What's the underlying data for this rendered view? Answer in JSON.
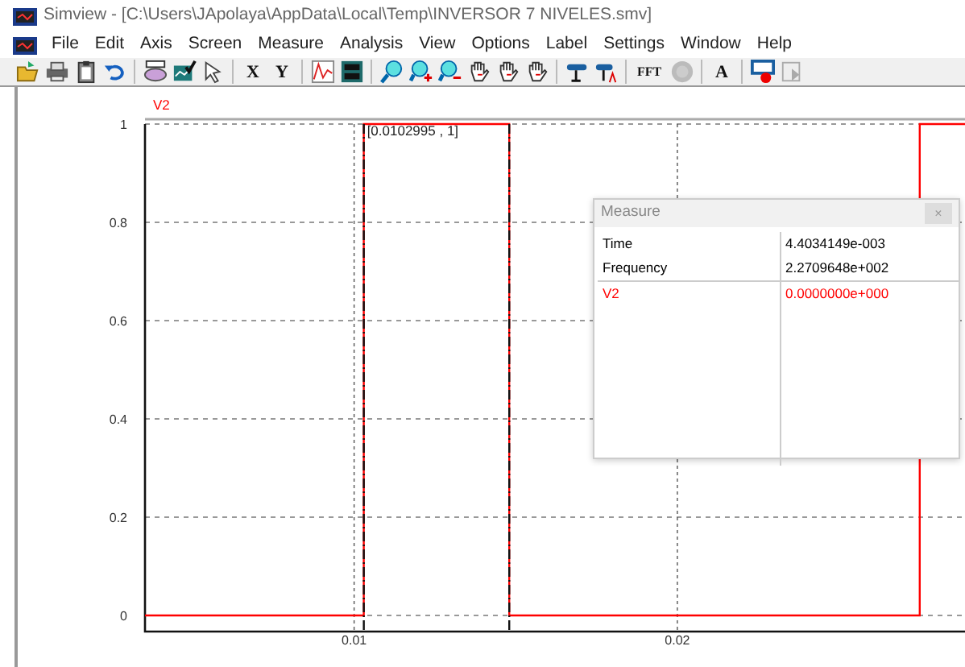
{
  "window": {
    "title": "Simview - [C:\\Users\\JApolaya\\AppData\\Local\\Temp\\INVERSOR 7 NIVELES.smv]"
  },
  "menu": [
    "File",
    "Edit",
    "Axis",
    "Screen",
    "Measure",
    "Analysis",
    "View",
    "Options",
    "Label",
    "Settings",
    "Window",
    "Help"
  ],
  "toolbar": {
    "labels": [
      "X",
      "Y",
      "FFT",
      "A"
    ]
  },
  "plot": {
    "chart_data": {
      "type": "line",
      "grid": true,
      "xlim": [
        0.00353,
        0.0289
      ],
      "ylim": [
        0,
        1
      ],
      "xticks": [
        0.01,
        0.02
      ],
      "yticks": [
        {
          "value": 0,
          "label": "0"
        },
        {
          "value": 0.2,
          "label": "0.2"
        },
        {
          "value": 0.4,
          "label": "0.4"
        },
        {
          "value": 0.6,
          "label": "0.6"
        },
        {
          "value": 0.8,
          "label": "0.8"
        },
        {
          "value": 1,
          "label": "1"
        }
      ],
      "x": [
        0.00353,
        0.0103,
        0.0103,
        0.0148,
        0.0148,
        0.0275,
        0.0275,
        0.0289
      ],
      "series": [
        {
          "name": "V2",
          "color": "#ff0000",
          "values": [
            0,
            0,
            1,
            1,
            0,
            0,
            1,
            1
          ]
        }
      ],
      "ref_lines": [
        {
          "axis": "x",
          "value": 0.0103
        },
        {
          "axis": "x",
          "value": 0.0148
        }
      ],
      "annotations": [
        {
          "x": 0.0103,
          "y": 1,
          "text": "[0.0102995 , 1]"
        }
      ]
    }
  },
  "measure": {
    "title": "Measure",
    "close": "×",
    "rows": [
      {
        "label": "Time",
        "value": "4.4034149e-003",
        "color": "#000000"
      },
      {
        "label": "Frequency",
        "value": "2.2709648e+002",
        "color": "#000000"
      },
      {
        "label": "V2",
        "value": "0.0000000e+000",
        "color": "#ff0000"
      }
    ]
  }
}
